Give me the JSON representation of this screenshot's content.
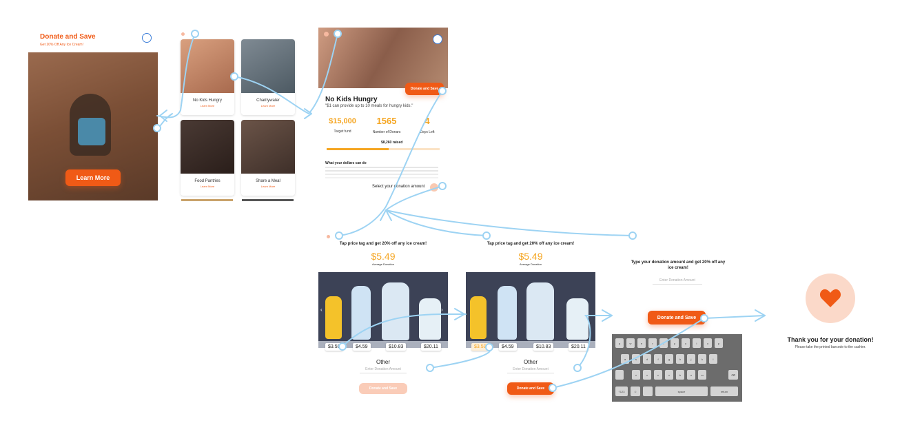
{
  "screen1": {
    "title": "Donate and Save",
    "subtitle": "Get 20% Off Any Ice Cream!",
    "cta": "Learn More"
  },
  "screen2": {
    "cards": [
      {
        "title": "No Kids Hungry",
        "link": "Learn More"
      },
      {
        "title": "Charitywater",
        "link": "Learn More"
      },
      {
        "title": "Food Pantries",
        "link": "Learn More"
      },
      {
        "title": "Share a Meal",
        "link": "Learn More"
      }
    ]
  },
  "screen3": {
    "donate_button": "Donate and Save",
    "title": "No Kids Hungry",
    "quote": "\"$1 can provide up to 10 meals for hungry kids.\"",
    "stats": [
      {
        "value": "$15,000",
        "label": "Target fund"
      },
      {
        "value": "1565",
        "label": "Number of Donars"
      },
      {
        "value": "4",
        "label": "Days Left"
      }
    ],
    "raised": "$8,260 raised",
    "raised_fraction": 0.55,
    "section_title": "What your dollars can do",
    "select_label": "Select your donation amount"
  },
  "screen4": {
    "headline": "Tap price tag and get 20% off any ice cream!",
    "avg_value": "$5.49",
    "avg_label": "Average Donation",
    "prices": [
      "$3.59",
      "$4.59",
      "$10.83",
      "$20.11"
    ],
    "other_label": "Other",
    "input_placeholder": "Enter Donation Amount",
    "button": "Donate and Save"
  },
  "screen5": {
    "headline": "Tap price tag and get 20% off any ice cream!",
    "avg_value": "$5.49",
    "avg_label": "Average Donation",
    "prices": [
      "$3.59",
      "$4.59",
      "$10.83",
      "$20.11"
    ],
    "other_label": "Other",
    "input_placeholder": "Enter Donation Amount",
    "button": "Donate and Save"
  },
  "screen6": {
    "headline": "Type your donation amount and get 20% off any ice cream!",
    "input_placeholder": "Enter Donation Amount",
    "button": "Donate and Save",
    "keyboard": {
      "row1": [
        "q",
        "w",
        "e",
        "r",
        "t",
        "y",
        "u",
        "i",
        "o",
        "p"
      ],
      "row2": [
        "a",
        "s",
        "d",
        "f",
        "g",
        "h",
        "j",
        "k",
        "l"
      ],
      "row3": [
        "z",
        "x",
        "c",
        "v",
        "b",
        "n",
        "m"
      ],
      "space": "space",
      "return": "return",
      "num": "?123"
    }
  },
  "screen7": {
    "title": "Thank you for your donation!",
    "subtitle": "Please take the printed barcode to the cashier.",
    "icon": "heart-icon"
  },
  "colors": {
    "accent": "#f05a16",
    "gold": "#f5a623",
    "flow": "#9dd3f3"
  }
}
